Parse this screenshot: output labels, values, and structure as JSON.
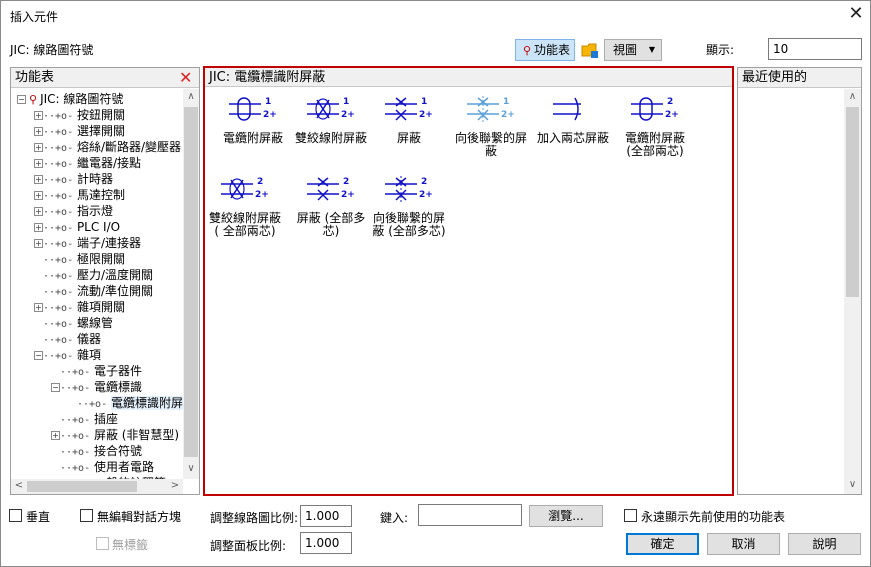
{
  "dialog": {
    "title": "插入元件",
    "library_path": "JIC: 線路圖符號",
    "menu_view_label": "功能表",
    "view_label": "視圖",
    "display_label": "顯示:",
    "display_value": "10"
  },
  "left_panel": {
    "title": "功能表",
    "tree": [
      {
        "label": "JIC: 線路圖符號"
      },
      {
        "label": "按鈕開關"
      },
      {
        "label": "選擇開關"
      },
      {
        "label": "熔絲/斷路器/變壓器"
      },
      {
        "label": "繼電器/接點"
      },
      {
        "label": "計時器"
      },
      {
        "label": "馬達控制"
      },
      {
        "label": "指示燈"
      },
      {
        "label": "PLC I/O"
      },
      {
        "label": "端子/連接器"
      },
      {
        "label": "極限開關"
      },
      {
        "label": "壓力/溫度開關"
      },
      {
        "label": "流動/準位開關"
      },
      {
        "label": "雜項開關"
      },
      {
        "label": "螺線管"
      },
      {
        "label": "儀器"
      },
      {
        "label": "雜項"
      },
      {
        "label": "電子器件"
      },
      {
        "label": "電纜標識"
      },
      {
        "label": "電纜標識附屏"
      },
      {
        "label": "插座"
      },
      {
        "label": "屏蔽 (非智慧型)"
      },
      {
        "label": "接合符號"
      },
      {
        "label": "使用者電路"
      },
      {
        "label": "一般的註釋等"
      }
    ]
  },
  "center_panel": {
    "title": "JIC: 電纜標識附屏蔽",
    "symbols": [
      {
        "label": "電纜附屏蔽",
        "icon": "cable-shield-icon"
      },
      {
        "label": "雙絞線附屏蔽",
        "icon": "twisted-pair-shield-icon"
      },
      {
        "label": "屏蔽",
        "icon": "shield-icon"
      },
      {
        "label": "向後聯繫的屏蔽",
        "icon": "shield-back-link-icon"
      },
      {
        "label": "加入兩芯屏蔽",
        "icon": "add-two-core-shield-icon"
      },
      {
        "label": "電纜附屏蔽 (全部兩芯)",
        "icon": "cable-shield-all-two-icon"
      },
      {
        "label": "雙絞線附屏蔽 ( 全部兩芯)",
        "icon": "twisted-pair-all-two-icon"
      },
      {
        "label": "屏蔽 (全部多芯)",
        "icon": "shield-all-multi-icon"
      },
      {
        "label": "向後聯繫的屏蔽 (全部多芯)",
        "icon": "shield-back-link-multi-icon"
      }
    ]
  },
  "right_panel": {
    "title": "最近使用的"
  },
  "bottom": {
    "vertical_label": "垂直",
    "no_edit_label": "無編輯對話方塊",
    "no_tag_label": "無標籤",
    "wiring_scale_label": "調整線路圖比例:",
    "wiring_scale_value": "1.000",
    "panel_scale_label": "調整面板比例:",
    "panel_scale_value": "1.000",
    "key_label": "鍵入:",
    "key_value": "",
    "browse_label": "瀏覽...",
    "always_show_label": "永遠顯示先前使用的功能表",
    "ok_label": "確定",
    "cancel_label": "取消",
    "help_label": "說明"
  },
  "colors": {
    "highlight_border": "#c00000",
    "symbol_blue": "#1010c8",
    "symbol_light_blue": "#5aa0d8"
  }
}
